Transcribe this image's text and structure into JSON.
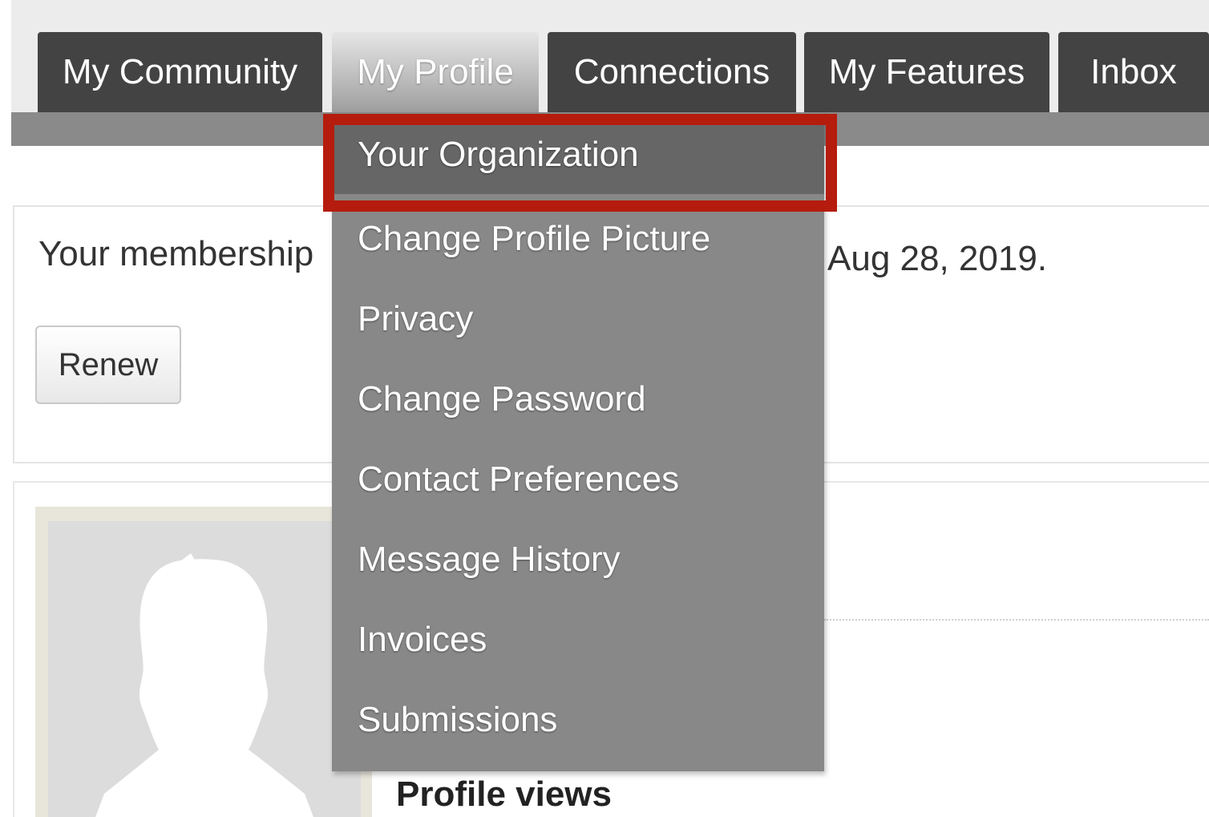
{
  "nav": {
    "tabs": [
      {
        "label": "My Community"
      },
      {
        "label": "My Profile",
        "active": true
      },
      {
        "label": "Connections"
      },
      {
        "label": "My Features"
      },
      {
        "label": "Inbox"
      }
    ]
  },
  "dropdown": {
    "items": [
      {
        "label": "Your Organization",
        "highlighted": true
      },
      {
        "label": "Change Profile Picture"
      },
      {
        "label": "Privacy"
      },
      {
        "label": "Change Password"
      },
      {
        "label": "Contact Preferences"
      },
      {
        "label": "Message History"
      },
      {
        "label": "Invoices"
      },
      {
        "label": "Submissions"
      }
    ]
  },
  "membership": {
    "text_visible_start": "Your membership",
    "text_visible_end": "Aug 28, 2019.",
    "renew_label": "Renew"
  },
  "profile": {
    "views_label": "Profile views"
  },
  "colors": {
    "tab_bg": "#434343",
    "subnav_bg": "#8a8a8a",
    "dropdown_bg": "#888888",
    "dropdown_highlight_bg": "#666666",
    "annotation_red": "#b51c0e"
  }
}
